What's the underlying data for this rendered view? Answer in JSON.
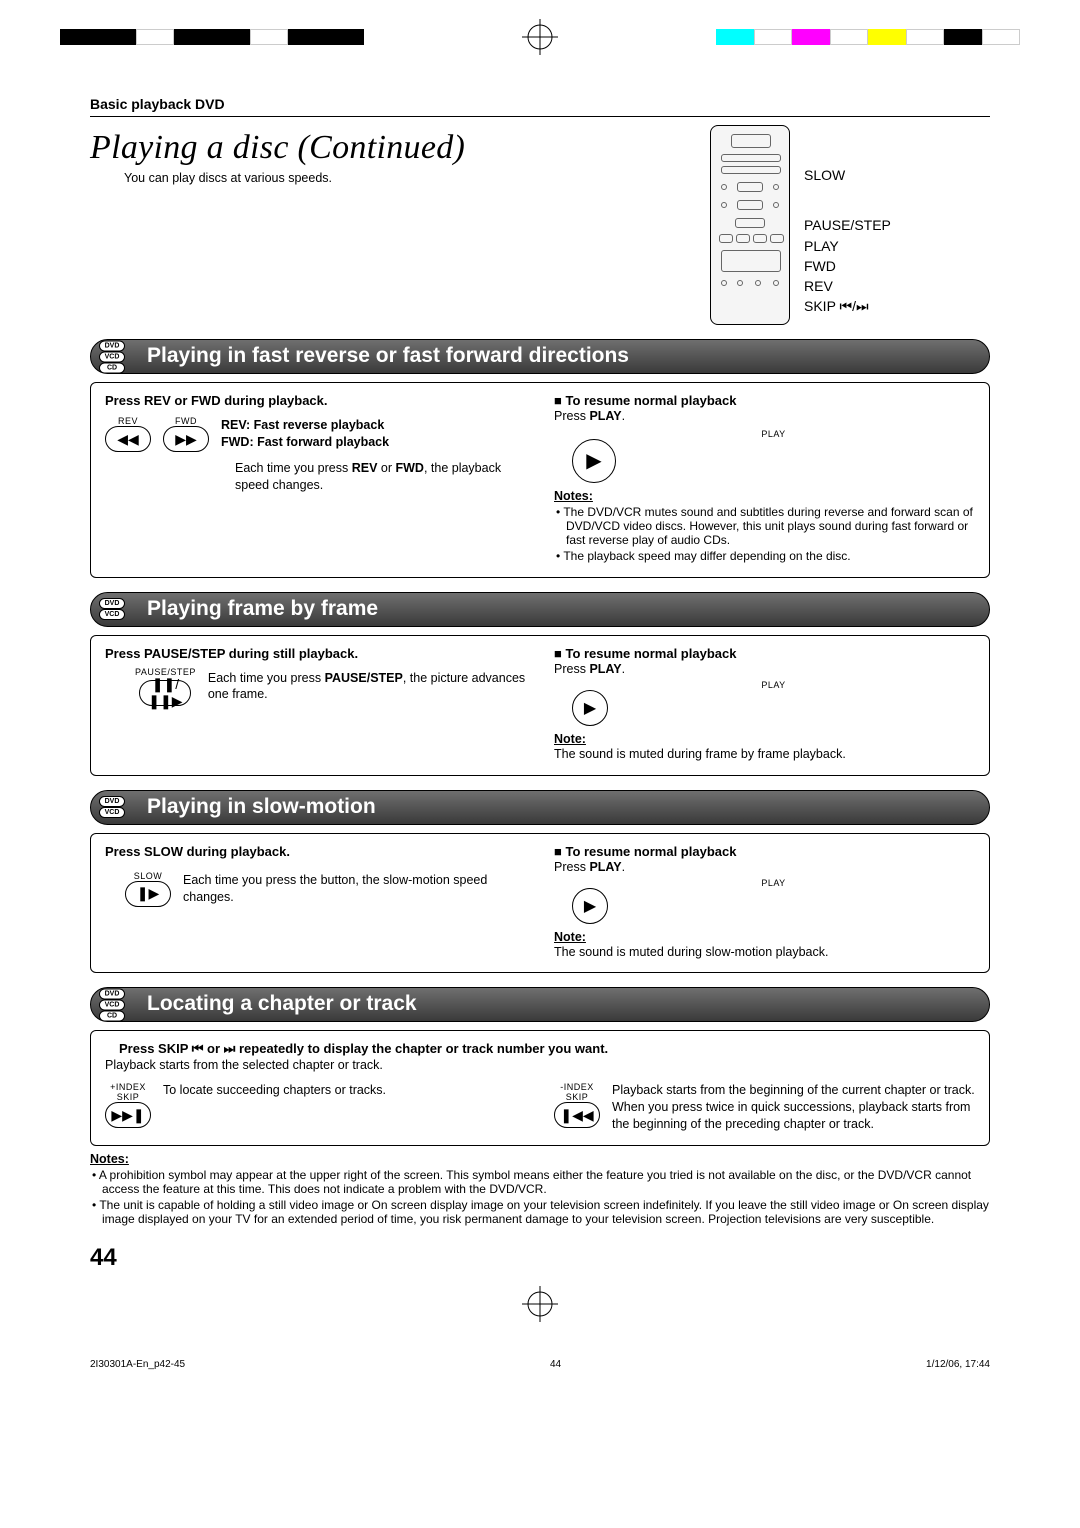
{
  "header": {
    "section_label": "Basic playback DVD"
  },
  "title": "Playing a disc (Continued)",
  "intro": "You can play discs at various speeds.",
  "remote_labels": [
    "SLOW",
    "PAUSE/STEP",
    "PLAY",
    "FWD",
    "REV",
    "SKIP ⏮/⏭"
  ],
  "sections": {
    "fast": {
      "badges": [
        "DVD",
        "VCD",
        "CD"
      ],
      "heading": "Playing in fast reverse or fast forward directions",
      "left_instr": "Press REV or FWD during playback.",
      "btn_labels": {
        "rev": "REV",
        "fwd": "FWD"
      },
      "defs": {
        "rev": "REV:  Fast reverse playback",
        "fwd": "FWD:  Fast forward playback"
      },
      "each_time_a": "Each time you press ",
      "each_time_bold": "REV",
      "each_time_mid": " or ",
      "each_time_bold2": "FWD",
      "each_time_b": ", the playback speed changes.",
      "resume_title": "To resume normal playback",
      "resume_text_a": "Press ",
      "resume_text_bold": "PLAY",
      "resume_text_b": ".",
      "play_btn": "PLAY",
      "notes_label": "Notes:",
      "notes": [
        "The DVD/VCR mutes sound and subtitles during reverse and forward scan of DVD/VCD video discs. However, this unit plays sound during fast forward or fast reverse play of audio CDs.",
        "The playback speed may differ depending on the disc."
      ]
    },
    "frame": {
      "badges": [
        "DVD",
        "VCD"
      ],
      "heading": "Playing frame by frame",
      "left_instr": "Press PAUSE/STEP during still playback.",
      "btn_label": "PAUSE/STEP",
      "each_time_a": "Each time you press ",
      "each_time_bold": "PAUSE/STEP",
      "each_time_b": ", the picture advances one frame.",
      "resume_title": "To resume normal playback",
      "resume_text_a": "Press ",
      "resume_text_bold": "PLAY",
      "resume_text_b": ".",
      "play_btn": "PLAY",
      "note_label": "Note:",
      "note": "The sound is muted during frame by frame playback."
    },
    "slow": {
      "badges": [
        "DVD",
        "VCD"
      ],
      "heading": "Playing in slow-motion",
      "left_instr": "Press SLOW during playback.",
      "btn_label": "SLOW",
      "each_time": "Each time you press the button, the slow-motion speed changes.",
      "resume_title": "To resume normal playback",
      "resume_text_a": "Press ",
      "resume_text_bold": "PLAY",
      "resume_text_b": ".",
      "play_btn": "PLAY",
      "note_label": "Note:",
      "note": "The sound is muted during slow-motion playback."
    },
    "locate": {
      "badges": [
        "DVD",
        "VCD",
        "CD"
      ],
      "heading": "Locating a chapter or track",
      "instr_bold": "Press SKIP ⏮ or ⏭ repeatedly to display the chapter or track number you want.",
      "instr_sub": "Playback starts from the selected chapter or track.",
      "skip_fwd_label_1": "+INDEX",
      "skip_fwd_label_2": "SKIP",
      "skip_fwd_text": "To locate succeeding chapters or tracks.",
      "skip_back_label_1": "-INDEX",
      "skip_back_label_2": "SKIP",
      "skip_back_text_1": "Playback starts from the beginning of the current chapter or track.",
      "skip_back_text_2": "When you press twice in quick successions, playback starts from the beginning of the preceding chapter or track."
    }
  },
  "final_notes_label": "Notes:",
  "final_notes": [
    "A prohibition symbol may appear at the upper right of the screen. This symbol means either the feature you tried is not available on the disc, or the DVD/VCR cannot access the feature at this time. This does not indicate a problem with the DVD/VCR.",
    "The unit is capable of holding a still video image or On screen display image on your television screen indefinitely. If you leave the still video image or On screen display image displayed on your TV for an extended period of time, you risk permanent damage to your television screen. Projection televisions are very susceptible."
  ],
  "page_number": "44",
  "footer": {
    "file": "2I30301A-En_p42-45",
    "page": "44",
    "date": "1/12/06, 17:44"
  }
}
